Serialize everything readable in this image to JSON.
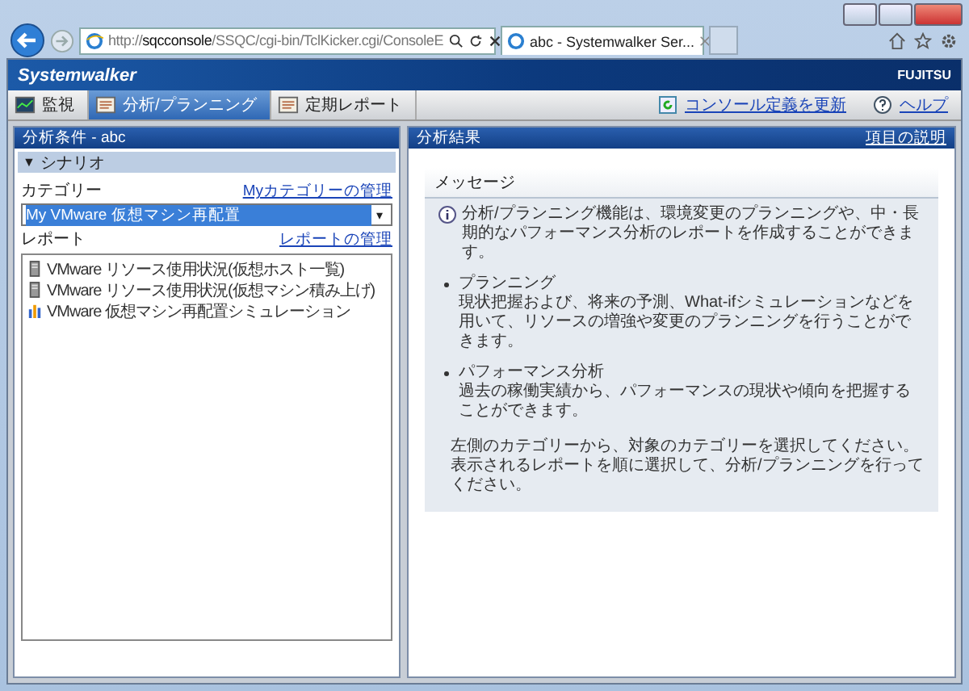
{
  "browser": {
    "address": "http://**sqcconsole**/SSQC/cgi-bin/TclKicker.cgi/ConsoleE",
    "tab_title": "abc - Systemwalker Ser..."
  },
  "header": {
    "logo": "Systemwalker",
    "brand": "FUJITSU"
  },
  "tabs": [
    {
      "label": "監視",
      "selected": false
    },
    {
      "label": "分析/プランニング",
      "selected": true
    },
    {
      "label": "定期レポート",
      "selected": false
    }
  ],
  "toolbar_links": [
    "コンソール定義を更新",
    "ヘルプ"
  ],
  "left_panel": {
    "title": "分析条件 - abc",
    "section": {
      "toggle": "▼",
      "label": "シナリオ",
      "expanded": true
    },
    "category_label": "カテゴリー",
    "category_link": "Myカテゴリーの管理",
    "category_value": "My VMware 仮想マシン再配置",
    "category_caret": "▾",
    "report_label": "レポート",
    "report_link": "レポートの管理",
    "reports": [
      {
        "label": "VMware リソース使用状況(仮想ホスト一覧)",
        "kind": "server"
      },
      {
        "label": "VMware リソース使用状況(仮想マシン積み上げ)",
        "kind": "server"
      },
      {
        "label": "VMware 仮想マシン再配置シミュレーション",
        "kind": "chart"
      }
    ]
  },
  "right_panel": {
    "title": "分析結果",
    "link": "項目の説明",
    "message": {
      "title": "メッセージ",
      "intro": "分析/プランニング機能は、環境変更のプランニングや、中・長期的なパフォーマンス分析のレポートを作成することができます。",
      "bullets": [
        {
          "title": "プランニング",
          "text": "現状把握および、将来の予測、What-ifシミュレーションなどを用いて、リソースの増強や変更のプランニングを行うことができます。"
        },
        {
          "title": "パフォーマンス分析",
          "text": "過去の稼働実績から、パフォーマンスの現状や傾向を把握することができます。"
        }
      ],
      "footer": "左側のカテゴリーから、対象のカテゴリーを選択してください。表示されるレポートを順に選択して、分析/プランニングを行ってください。"
    }
  }
}
